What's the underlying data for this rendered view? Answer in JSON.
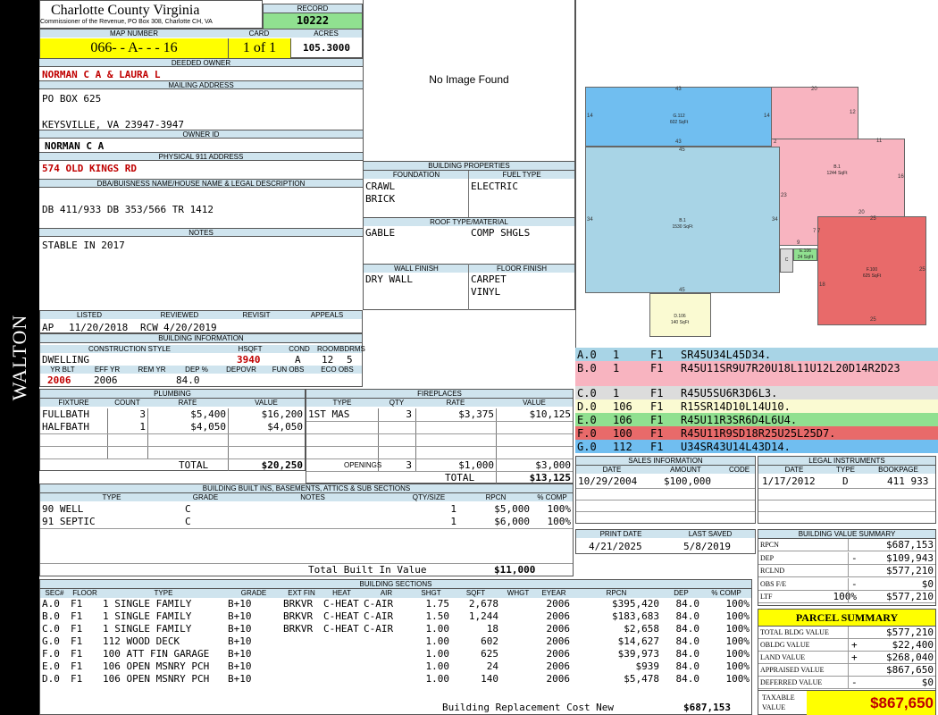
{
  "sidebar": {
    "name": "WALTON"
  },
  "header": {
    "county": "Charlotte County Virginia",
    "commissioner": "Commissioner of the Revenue, PO Box 308, Charlotte CH, VA",
    "record_label": "RECORD",
    "record": "10222"
  },
  "parcel": {
    "map_label": "MAP NUMBER",
    "map": "066- - A- - - 16",
    "card_label": "CARD",
    "card": "1 of 1",
    "acres_label": "ACRES",
    "acres": "105.3000",
    "owner_label": "DEEDED OWNER",
    "owner": "NORMAN C A & LAURA L",
    "mailing_label": "MAILING ADDRESS",
    "mail1": "PO BOX 625",
    "mail2": "KEYSVILLE, VA 23947-3947",
    "ownerid_label": "OWNER ID",
    "ownerid": "NORMAN C A",
    "phys_label": "PHYSICAL 911 ADDRESS",
    "phys": "574 OLD KINGS RD",
    "dba_label": "DBA/BUISNESS NAME/HOUSE NAME & LEGAL DESCRIPTION",
    "legal": "DB 411/933 DB 353/566 TR 1412",
    "notes_label": "NOTES",
    "notes": "STABLE IN 2017"
  },
  "image": {
    "text": "No Image Found"
  },
  "building_props": {
    "title": "BUILDING PROPERTIES",
    "foundation_label": "FOUNDATION",
    "fuel_label": "FUEL TYPE",
    "foundation1": "CRAWL",
    "foundation2": "BRICK",
    "fuel": "ELECTRIC",
    "roof_label": "ROOF TYPE/MATERIAL",
    "roof1": "GABLE",
    "roof2": "COMP SHGLS",
    "wall_label": "WALL FINISH",
    "floor_label": "FLOOR FINISH",
    "wall": "DRY WALL",
    "floor1": "CARPET",
    "floor2": "VINYL"
  },
  "review": {
    "listed_label": "LISTED",
    "reviewed_label": "REVIEWED",
    "revisit_label": "REVISIT",
    "appeals_label": "APPEALS",
    "listed_by": "AP",
    "listed": "11/20/2018",
    "reviewed_by": "RCW",
    "reviewed": "4/20/2019"
  },
  "building_info": {
    "title": "BUILDING INFORMATION",
    "style_label": "CONSTRUCTION STYLE",
    "hsqft_label": "HSQFT",
    "cond_label": "COND",
    "rooms_label": "ROOMS",
    "bdrms_label": "BDRMS",
    "style": "DWELLING",
    "hsqft": "3940",
    "cond": "A",
    "rooms": "12",
    "bdrms": "5",
    "yrblt_label": "YR BLT",
    "effyr_label": "EFF YR",
    "remyr_label": "REM YR",
    "dep_label": "DEP %",
    "depovr_label": "DEPOVR",
    "funobs_label": "FUN OBS",
    "ecoobs_label": "ECO OBS",
    "yrblt": "2006",
    "effyr": "2006",
    "dep": "84.0"
  },
  "plumbing": {
    "title": "PLUMBING",
    "headers": [
      "FIXTURE",
      "COUNT",
      "RATE",
      "VALUE"
    ],
    "rows": [
      [
        "FULLBATH",
        "3",
        "$5,400",
        "$16,200"
      ],
      [
        "HALFBATH",
        "1",
        "$4,050",
        "$4,050"
      ]
    ],
    "total_label": "TOTAL",
    "total": "$20,250"
  },
  "fireplaces": {
    "title": "FIREPLACES",
    "headers": [
      "TYPE",
      "QTY",
      "RATE",
      "VALUE"
    ],
    "rows": [
      [
        "1ST MAS",
        "3",
        "$3,375",
        "$10,125"
      ]
    ],
    "openings_label": "OPENINGS",
    "openings_qty": "3",
    "openings_rate": "$1,000",
    "openings_value": "$3,000",
    "total_label": "TOTAL",
    "total": "$13,125"
  },
  "builtins": {
    "title": "BUILDING BUILT INS, BASEMENTS, ATTICS & SUB SECTIONS",
    "headers": [
      "TYPE",
      "GRADE",
      "NOTES",
      "QTY/SIZE",
      "RPCN",
      "% COMP"
    ],
    "rows": [
      [
        "90 WELL",
        "C",
        "",
        "1",
        "$5,000",
        "100%"
      ],
      [
        "91 SEPTIC",
        "C",
        "",
        "1",
        "$6,000",
        "100%"
      ]
    ],
    "total_label": "Total Built In Value",
    "total": "$11,000"
  },
  "sketch": {
    "sections": [
      {
        "code": "A.0",
        "c1": "1",
        "c2": "F1",
        "desc": "SR45U34L45D34.",
        "color": "#a8d4e6"
      },
      {
        "code": "B.0",
        "c1": "1",
        "c2": "F1",
        "desc": "R45U11SR9U7R20U18L11U12L20D14R2D23",
        "color": "#f8b4c0"
      },
      {
        "code": "C.0",
        "c1": "1",
        "c2": "F1",
        "desc": "R45U5SU6R3D6L3.",
        "color": "#dcdcdc"
      },
      {
        "code": "D.0",
        "c1": "106",
        "c2": "F1",
        "desc": "R15SR14D10L14U10.",
        "color": "#fafad2"
      },
      {
        "code": "E.0",
        "c1": "106",
        "c2": "F1",
        "desc": "R45U11R3SR6D4L6U4.",
        "color": "#90e090"
      },
      {
        "code": "F.0",
        "c1": "100",
        "c2": "F1",
        "desc": "R45U11R9SD18R25U25L25D7.",
        "color": "#e86a6a"
      },
      {
        "code": "G.0",
        "c1": "112",
        "c2": "F1",
        "desc": "U34SR43U14L43D14.",
        "color": "#70bef0"
      }
    ],
    "labels": {
      "g_name": "G.112",
      "g_sqft": "602 SqFt",
      "b1_name": "B.1",
      "b1_sqft": "1244 SqFt",
      "a_name": "B.1",
      "a_sqft": "1530 SqFt",
      "e_name": "E.106",
      "e_sqft": "24 SqFt",
      "c_name": "C",
      "f_name": "F.100",
      "f_sqft": "625 SqFt",
      "d_name": "D.106",
      "d_sqft": "140 SqFt"
    },
    "dims": {
      "d43a": "43",
      "d14a": "14",
      "d14b": "14",
      "d43b": "43",
      "d20": "20",
      "d12": "12",
      "d11": "11",
      "d16": "16",
      "d45a": "45",
      "d34a": "34",
      "d34b": "34",
      "d23": "23",
      "d2": "2",
      "d20b": "20",
      "d25a": "25",
      "d25b": "25",
      "d25c": "25",
      "d18": "18",
      "d9": "9",
      "d7": "7 7",
      "d45b": "45"
    }
  },
  "sales": {
    "title": "SALES INFORMATION",
    "headers": [
      "DATE",
      "AMOUNT",
      "CODE"
    ],
    "date": "10/29/2004",
    "amount": "$100,000",
    "code": ""
  },
  "legal_instr": {
    "title": "LEGAL INSTRUMENTS",
    "headers": [
      "DATE",
      "TYPE",
      "BOOKPAGE"
    ],
    "date": "1/17/2012",
    "type": "D",
    "bookpage": "411 933"
  },
  "dates": {
    "print_label": "PRINT DATE",
    "saved_label": "LAST SAVED",
    "print": "4/21/2025",
    "saved": "5/8/2019"
  },
  "value_summary": {
    "title": "BUILDING VALUE SUMMARY",
    "rows": [
      [
        "RPCN",
        "",
        "$687,153"
      ],
      [
        "DEP",
        "-",
        "$109,943"
      ],
      [
        "RCLND",
        "",
        "$577,210"
      ],
      [
        "OBS F/E",
        "-",
        "$0"
      ],
      [
        "LTF",
        "100%",
        "$577,210"
      ]
    ]
  },
  "parcel_summary": {
    "title": "PARCEL SUMMARY",
    "rows": [
      [
        "TOTAL BLDG VALUE",
        "",
        "$577,210"
      ],
      [
        "OBLDG VALUE",
        "+",
        "$22,400"
      ],
      [
        "LAND VALUE",
        "+",
        "$268,040"
      ],
      [
        "APPRAISED VALUE",
        "",
        "$867,650"
      ],
      [
        "DEFERRED VALUE",
        "-",
        "$0"
      ]
    ],
    "taxable_label1": "TAXABLE",
    "taxable_label2": "VALUE",
    "taxable": "$867,650"
  },
  "sections": {
    "title": "BUILDING SECTIONS",
    "headers": [
      "SEC#",
      "FLOOR",
      "TYPE",
      "GRADE",
      "EXT FIN",
      "HEAT",
      "AIR",
      "SHGT",
      "SQFT",
      "WHGT",
      "EYEAR",
      "RPCN",
      "DEP",
      "% COMP"
    ],
    "rows": [
      [
        "A.0",
        "F1",
        "1 SINGLE FAMILY",
        "B+10",
        "BRKVR",
        "C-HEAT",
        "C-AIR",
        "1.75",
        "2,678",
        "",
        "2006",
        "$395,420",
        "84.0",
        "100%"
      ],
      [
        "B.0",
        "F1",
        "1 SINGLE FAMILY",
        "B+10",
        "BRKVR",
        "C-HEAT",
        "C-AIR",
        "1.50",
        "1,244",
        "",
        "2006",
        "$183,683",
        "84.0",
        "100%"
      ],
      [
        "C.0",
        "F1",
        "1 SINGLE FAMILY",
        "B+10",
        "BRKVR",
        "C-HEAT",
        "C-AIR",
        "1.00",
        "18",
        "",
        "2006",
        "$2,658",
        "84.0",
        "100%"
      ],
      [
        "G.0",
        "F1",
        "112 WOOD DECK",
        "B+10",
        "",
        "",
        "",
        "1.00",
        "602",
        "",
        "2006",
        "$14,627",
        "84.0",
        "100%"
      ],
      [
        "F.0",
        "F1",
        "100 ATT FIN GARAGE",
        "B+10",
        "",
        "",
        "",
        "1.00",
        "625",
        "",
        "2006",
        "$39,973",
        "84.0",
        "100%"
      ],
      [
        "E.0",
        "F1",
        "106 OPEN MSNRY PCH",
        "B+10",
        "",
        "",
        "",
        "1.00",
        "24",
        "",
        "2006",
        "$939",
        "84.0",
        "100%"
      ],
      [
        "D.0",
        "F1",
        "106 OPEN MSNRY PCH",
        "B+10",
        "",
        "",
        "",
        "1.00",
        "140",
        "",
        "2006",
        "$5,478",
        "84.0",
        "100%"
      ]
    ],
    "total_label": "Building Replacement Cost New",
    "total": "$687,153"
  }
}
